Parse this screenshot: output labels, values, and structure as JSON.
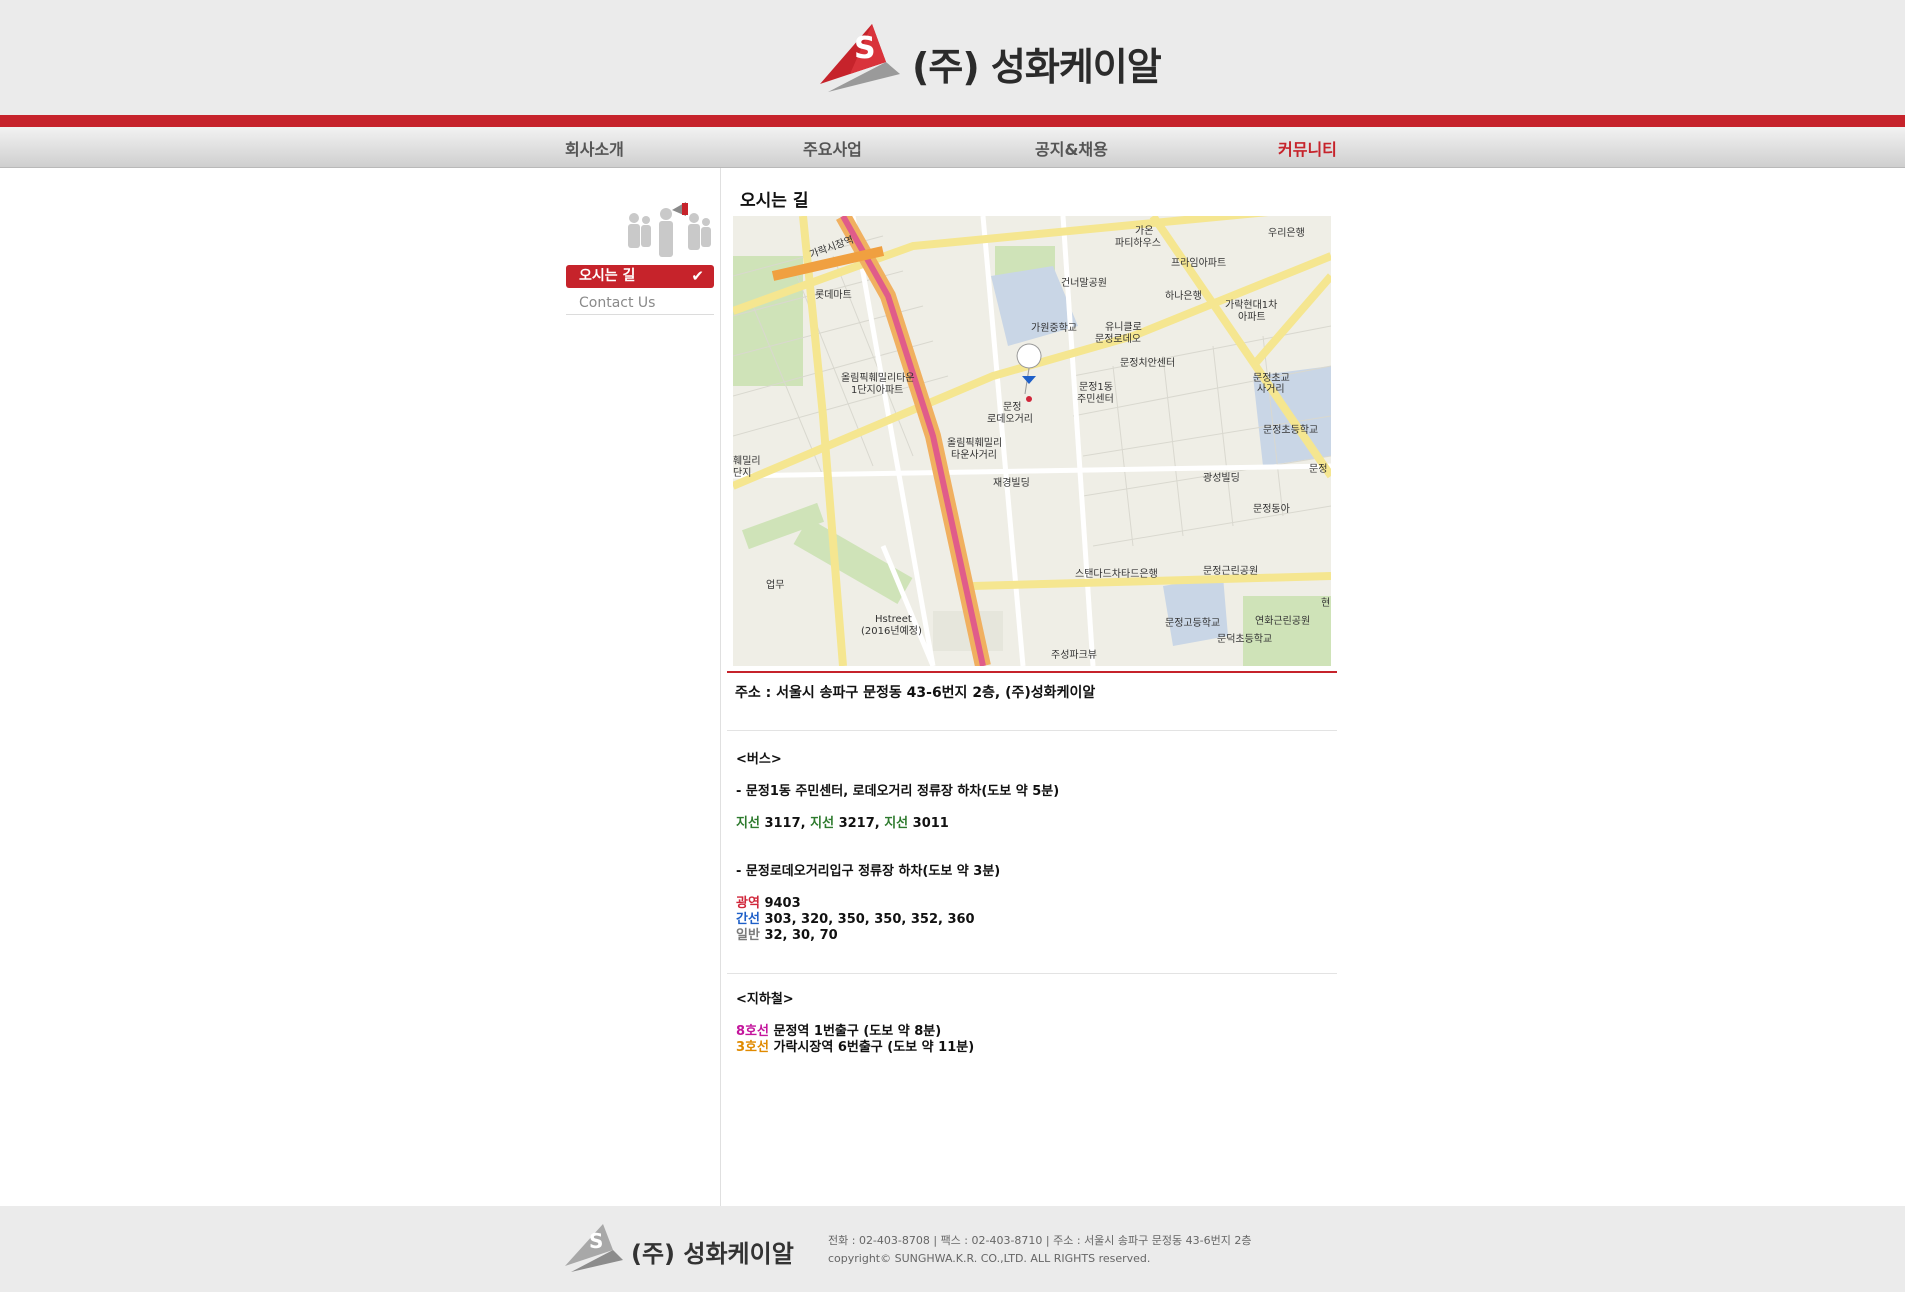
{
  "header": {
    "company_name": "(주) 성화케이알"
  },
  "nav": [
    {
      "label": "회사소개"
    },
    {
      "label": "주요사업"
    },
    {
      "label": "공지&채용"
    },
    {
      "label": "커뮤니티"
    }
  ],
  "sidebar": {
    "items": [
      {
        "label": "오시는 길",
        "active": true
      },
      {
        "label": "Contact Us",
        "active": false
      }
    ]
  },
  "content": {
    "title": "오시는 길",
    "address": "주소 : 서울시 송파구 문정동 43-6번지 2층, (주)성화케이알",
    "bus": {
      "heading": "<버스>",
      "stop1": "- 문정1동 주민센터, 로데오거리 정류장 하차(도보 약 5분)",
      "stop1_routes": [
        {
          "type": "지선",
          "number": "3117",
          "sep": ", "
        },
        {
          "type": "지선",
          "number": "3217",
          "sep": ", "
        },
        {
          "type": "지선",
          "number": "3011",
          "sep": ""
        }
      ],
      "stop2": " - 문정로데오거리입구 정류장 하차(도보 약 3분)",
      "stop2_lines": [
        {
          "type": "광역",
          "numbers": "9403"
        },
        {
          "type": "간선",
          "numbers": "303, 320, 350, 350, 352, 360"
        },
        {
          "type": "일반",
          "numbers": "32, 30, 70"
        }
      ]
    },
    "subway": {
      "heading": "<지하철>",
      "lines": [
        {
          "line": "8호선",
          "desc": "문정역 1번출구 (도보 약 8분)"
        },
        {
          "line": "3호선",
          "desc": "가락시장역 6번출구 (도보 약 11분)"
        }
      ]
    }
  },
  "map": {
    "labels": {
      "garak_station": "가락시장역",
      "lotte_mart": "롯데마트",
      "gaon": "가온",
      "party_house": "파티하우스",
      "woori_bank": "우리은행",
      "prime_apt": "프라임아파트",
      "geonneomal_park": "건너말공원",
      "hana_bank": "하나은행",
      "garak_hyundai": "가락현대1차",
      "apt": "아파트",
      "giwon_ms": "가원중학교",
      "unicro": "유니클로",
      "munjeong_rodeo": "문정로데오",
      "munjeong_police": "문정치안센터",
      "olympic_family": "올림픽훼밀리타운",
      "complex1": "1단지아파트",
      "munjeong1": "문정1동",
      "community_center": "주민센터",
      "munjeong_es_junction": "문정초교",
      "junction": "사거리",
      "munjeong_es": "문정초등학교",
      "olympic_junction": "올림픽훼밀리",
      "town_junction": "타운사거리",
      "rodeo_pin": "로데오거리",
      "munjeong_pin": "문정",
      "jaegyeong": "재경빌딩",
      "gwangseong": "광성빌딩",
      "munjeong_donga": "문정동아",
      "standard_chartered": "스탠다드차타드은행",
      "munjeong_park": "문정근린공원",
      "business": "업무",
      "hstreet": "Hstreet",
      "hstreet_year": "(2016년예정)",
      "munjeong_hs": "문정고등학교",
      "yeonhwa_park": "연화근린공원",
      "mundeok_es": "문덕초등학교",
      "jusung_park": "주성파크뷰",
      "family_left": "훼밀리",
      "complex_left": "단지",
      "munjeong_right": "문정",
      "hyeon": "현"
    }
  },
  "footer": {
    "company_name": "(주) 성화케이알",
    "contact": "전화 : 02-403-8708      |      팩스 : 02-403-8710      |      주소 : 서울시 송파구 문정동 43-6번지 2층",
    "copyright": "copyright© SUNGHWA.K.R. CO.,LTD. ALL RIGHTS reserved."
  }
}
